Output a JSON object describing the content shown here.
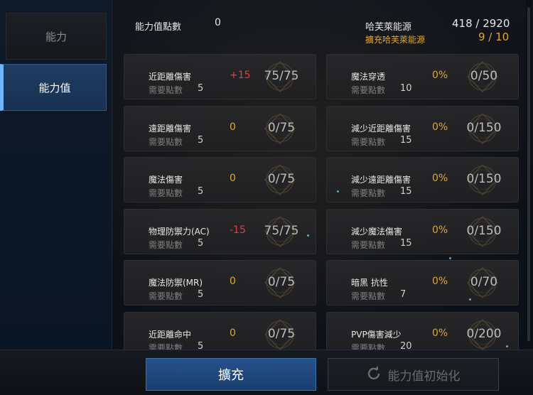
{
  "sidebar": {
    "tabs": [
      {
        "label": "能力"
      },
      {
        "label": "能力值"
      }
    ]
  },
  "header": {
    "points_label": "能力值點數",
    "points_value": "0",
    "essence_label": "哈芙萊能源",
    "essence_value": "418 / 2920",
    "expand_label": "擴充哈芙萊能源",
    "expand_value": "9 / 10"
  },
  "req_label": "需要點數",
  "stats_left": [
    {
      "name": "近距離傷害",
      "req": "5",
      "bonus": "+15",
      "bonus_kind": "pos",
      "progress": "75/75"
    },
    {
      "name": "遠距離傷害",
      "req": "5",
      "bonus": "0",
      "bonus_kind": "zero",
      "progress": "0/75"
    },
    {
      "name": "魔法傷害",
      "req": "5",
      "bonus": "0",
      "bonus_kind": "zero",
      "progress": "0/75"
    },
    {
      "name": "物理防禦力(AC)",
      "req": "5",
      "bonus": "-15",
      "bonus_kind": "neg",
      "progress": "75/75"
    },
    {
      "name": "魔法防禦(MR)",
      "req": "5",
      "bonus": "0",
      "bonus_kind": "zero",
      "progress": "0/75"
    },
    {
      "name": "近距離命中",
      "req": "5",
      "bonus": "0",
      "bonus_kind": "zero",
      "progress": "0/75"
    }
  ],
  "stats_right": [
    {
      "name": "魔法穿透",
      "req": "10",
      "bonus": "0%",
      "progress": "0/50"
    },
    {
      "name": "減少近距離傷害",
      "req": "15",
      "bonus": "0%",
      "progress": "0/150"
    },
    {
      "name": "減少遠距離傷害",
      "req": "15",
      "bonus": "0%",
      "progress": "0/150"
    },
    {
      "name": "減少魔法傷害",
      "req": "15",
      "bonus": "0%",
      "progress": "0/150"
    },
    {
      "name": "暗黑 抗性",
      "req": "7",
      "bonus": "0%",
      "progress": "0/70"
    },
    {
      "name": "PVP傷害減少",
      "req": "20",
      "bonus": "0%",
      "progress": "0/200"
    }
  ],
  "buttons": {
    "expand": "擴充",
    "reset": "能力值初始化"
  },
  "colors": {
    "accent_gold": "#e0a63a",
    "accent_red": "#e04040",
    "button_blue": "#25518a"
  }
}
